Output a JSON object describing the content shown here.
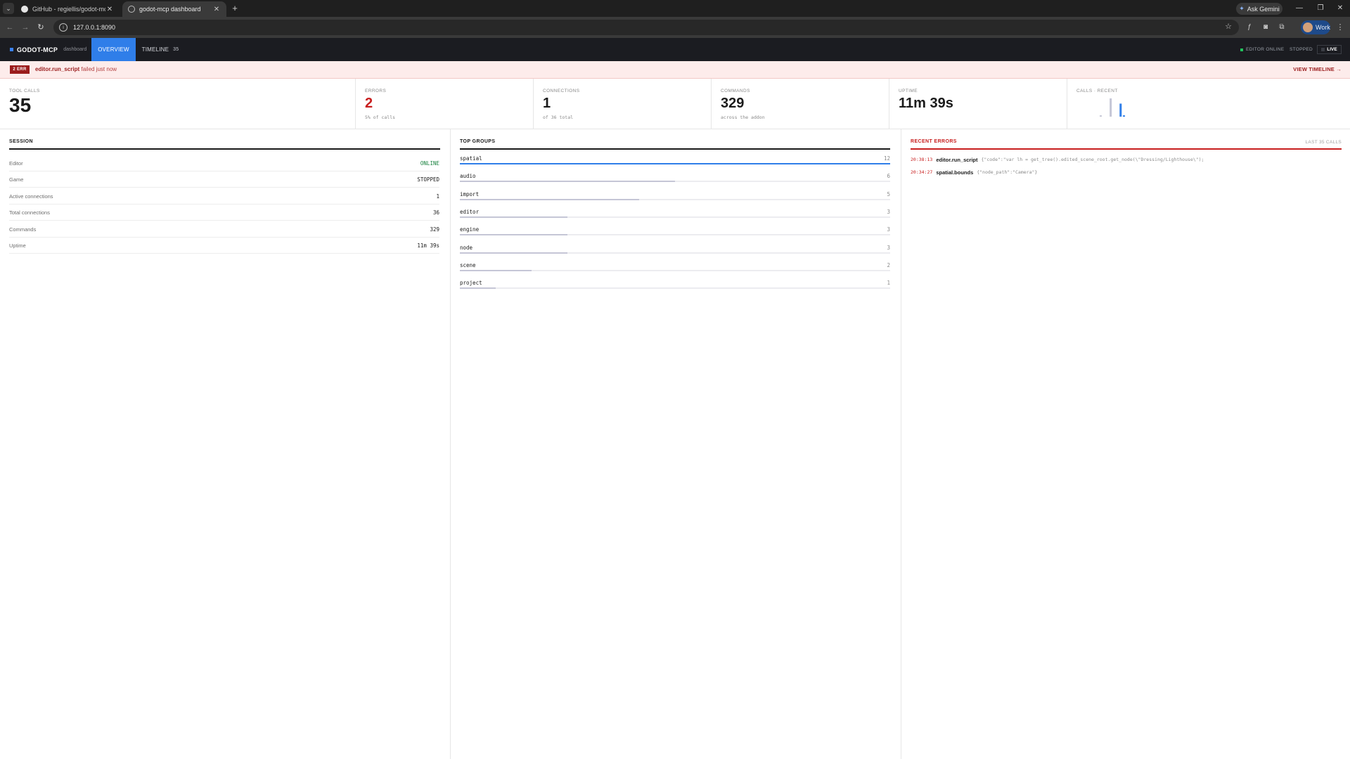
{
  "browser": {
    "tabs": [
      {
        "title": "GitHub - regiellis/godot-mcp-g",
        "active": false
      },
      {
        "title": "godot-mcp dashboard",
        "active": true
      }
    ],
    "url": "127.0.0.1:8090",
    "gemini_label": "Ask Gemini",
    "profile_label": "Work"
  },
  "app": {
    "brand": "GODOT-MCP",
    "brand_sub": "dashboard",
    "tabs": [
      {
        "label": "OVERVIEW",
        "active": true
      },
      {
        "label": "TIMELINE",
        "count": "35",
        "active": false
      }
    ],
    "status": {
      "editor": "EDITOR ONLINE",
      "game": "STOPPED",
      "live": "LIVE"
    },
    "colors": {
      "accent": "#2f7ee9",
      "error": "#c81e1e",
      "ok": "#17803d",
      "header_bg": "#1b1c21"
    }
  },
  "alert": {
    "badge": "2 ERR",
    "tool": "editor.run_script",
    "message": "failed just now",
    "link": "VIEW TIMELINE →"
  },
  "stats": {
    "tool_calls": {
      "label": "TOOL CALLS",
      "value": "35"
    },
    "errors": {
      "label": "ERRORS",
      "value": "2",
      "sub": "5% of calls"
    },
    "connections": {
      "label": "CONNECTIONS",
      "value": "1",
      "sub": "of 36 total"
    },
    "commands": {
      "label": "COMMANDS",
      "value": "329",
      "sub": "across the addon"
    },
    "uptime": {
      "label": "UPTIME",
      "value": "11m 39s"
    },
    "calls_recent": {
      "label": "CALLS · RECENT"
    }
  },
  "chart_data": {
    "type": "bar",
    "title": "CALLS · RECENT",
    "values": [
      1,
      0,
      0,
      14,
      0,
      0,
      10,
      1
    ],
    "colors": [
      "#c5c6d6",
      "#c5c6d6",
      "#c5c6d6",
      "#c5c6d6",
      "#c5c6d6",
      "#c5c6d6",
      "#2f7ee9",
      "#2f7ee9"
    ],
    "ylim": [
      0,
      14
    ]
  },
  "session": {
    "title": "SESSION",
    "rows": [
      {
        "key": "Editor",
        "value": "ONLINE"
      },
      {
        "key": "Game",
        "value": "STOPPED"
      },
      {
        "key": "Active connections",
        "value": "1"
      },
      {
        "key": "Total connections",
        "value": "36"
      },
      {
        "key": "Commands",
        "value": "329"
      },
      {
        "key": "Uptime",
        "value": "11m 39s"
      }
    ]
  },
  "top_groups": {
    "title": "TOP GROUPS",
    "max": 12,
    "groups": [
      {
        "name": "spatial",
        "count": 12
      },
      {
        "name": "audio",
        "count": 6
      },
      {
        "name": "import",
        "count": 5
      },
      {
        "name": "editor",
        "count": 3
      },
      {
        "name": "engine",
        "count": 3
      },
      {
        "name": "node",
        "count": 3
      },
      {
        "name": "scene",
        "count": 2
      },
      {
        "name": "project",
        "count": 1
      }
    ]
  },
  "recent_errors": {
    "title": "RECENT ERRORS",
    "subtitle": "LAST 35 CALLS",
    "items": [
      {
        "time": "20:38:13",
        "tool": "editor.run_script",
        "args": "{\"code\":\"var lh = get_tree().edited_scene_root.get_node(\\\"Dressing/Lighthouse\\\");"
      },
      {
        "time": "20:34:27",
        "tool": "spatial.bounds",
        "args": "{\"node_path\":\"Camera\"}"
      }
    ]
  }
}
